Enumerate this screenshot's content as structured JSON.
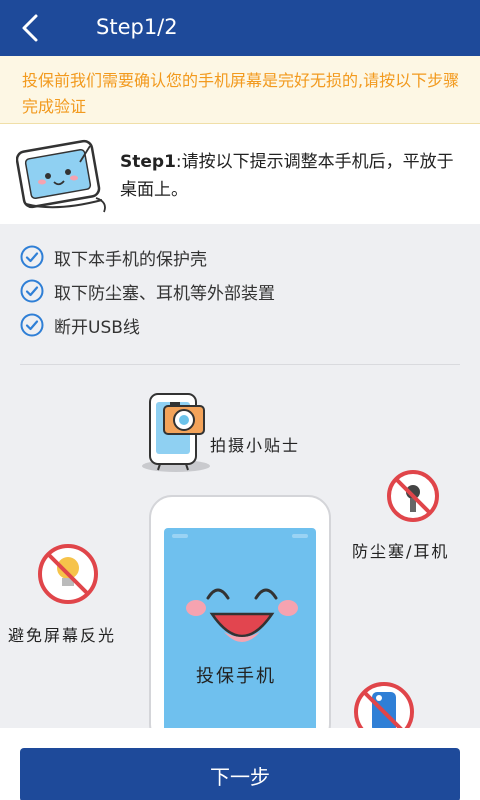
{
  "header": {
    "title": "Step1/2",
    "back_icon": "chevron-left-icon"
  },
  "notice": {
    "text": "投保前我们需要确认您的手机屏幕是完好无损的,请按以下步骤完成验证"
  },
  "step": {
    "label": "Step1",
    "text": ":请按以下提示调整本手机后，平放于桌面上。"
  },
  "checklist": [
    {
      "label": "取下本手机的保护壳"
    },
    {
      "label": "取下防尘塞、耳机等外部装置"
    },
    {
      "label": "断开USB线"
    }
  ],
  "illustration": {
    "tips_label": "拍摄小贴士",
    "dust_label": "防尘塞/耳机",
    "glare_label": "避免屏幕反光",
    "phone_label": "投保手机"
  },
  "footer": {
    "next_label": "下一步"
  },
  "colors": {
    "primary": "#1e4a9a",
    "notice_text": "#f29a1e",
    "check": "#2f7fd6",
    "forbid": "#e0454a"
  }
}
